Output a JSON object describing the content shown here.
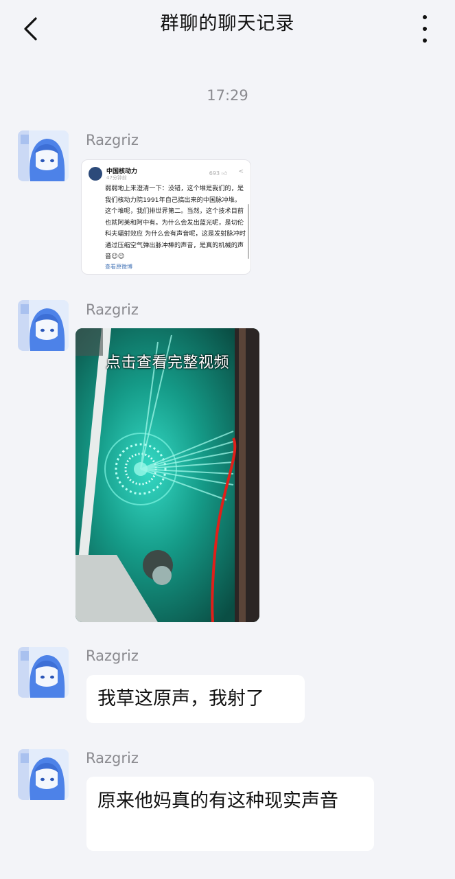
{
  "header": {
    "title": "群聊的聊天记录",
    "back_icon": "chevron-left-icon",
    "more_icon": "more-vertical-icon"
  },
  "timestamp": "17:29",
  "messages": [
    {
      "sender": "Razgriz",
      "type": "shared-post",
      "post": {
        "account": "中国核动力",
        "time": "47分钟前",
        "likes": "693",
        "body": "弱弱地上来澄清一下：没错，这个堆是我们的，是我们核动力院1991年自己搞出来的中国脉冲堆。这个堆呢，我们排世界第二。当然，这个技术目前也就阿美和阿中有。为什么会发出蓝光呢，是切伦科夫辐射效应 为什么会有声音呢，这是发射脉冲时通过压缩空气弹出脉冲棒的声音，是真的机械的声音😉😉",
        "link": "查看原微博"
      }
    },
    {
      "sender": "Razgriz",
      "type": "video",
      "caption": "点击查看完整视频"
    },
    {
      "sender": "Razgriz",
      "type": "text",
      "text": "我草这原声，我射了"
    },
    {
      "sender": "Razgriz",
      "type": "text",
      "text": "原来他妈真的有这种现实声音"
    }
  ]
}
